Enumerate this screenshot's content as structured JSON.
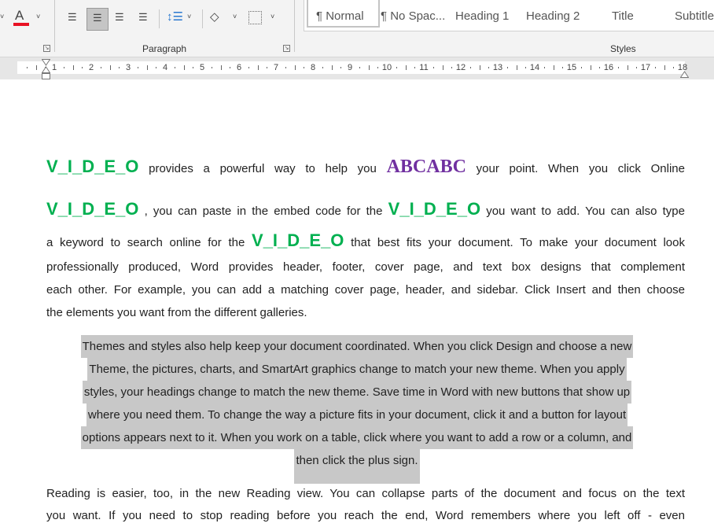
{
  "ribbon": {
    "groups": {
      "paragraph": "Paragraph",
      "styles": "Styles"
    },
    "icons": [
      "font-color-icon",
      "align-left-icon",
      "align-center-icon",
      "align-right-icon",
      "justify-icon",
      "line-spacing-icon",
      "shading-icon",
      "borders-icon"
    ],
    "font_color": "#e81123",
    "styles": [
      {
        "label": "¶ Normal"
      },
      {
        "label": "¶ No Spac..."
      },
      {
        "label": "Heading 1"
      },
      {
        "label": "Heading 2"
      },
      {
        "label": "Title"
      },
      {
        "label": "Subtitle"
      }
    ]
  },
  "ruler": {
    "numbers": [
      1,
      2,
      3,
      4,
      5,
      6,
      7,
      8,
      9,
      10,
      11,
      12,
      13,
      14,
      15,
      16,
      17,
      18
    ]
  },
  "document": {
    "colors": {
      "video": "#00b050",
      "abc": "#7030a0",
      "highlight": "#c8c8c8"
    },
    "p1": {
      "l1": [
        "V_I_D_E_O",
        " provides a powerful way to help you ",
        "ABCABC",
        " your point. When you click Online"
      ],
      "l2": [
        "V_I_D_E_O",
        " , you can paste in the embed code for the ",
        "V_I_D_E_O",
        " you want to add. You can also type"
      ],
      "l3": [
        "a keyword to search online for the ",
        "V_I_D_E_O",
        " that best fits your document. To make your document look"
      ],
      "l4": "professionally produced, Word provides header, footer, cover page, and text box designs that complement",
      "l5": "each other. For example, you can add a matching cover page, header, and sidebar. Click Insert and then choose",
      "l6": "the elements you want from the different galleries."
    },
    "p2": [
      "Themes and styles also help keep your document coordinated. When you click Design and choose a new",
      "Theme, the pictures, charts, and SmartArt graphics change to match your new theme. When you apply",
      "styles, your headings change to match the new theme. Save time in Word with new buttons that show up",
      "where you need them. To change the way a picture fits in your document, click it and a button for layout",
      "options appears next to it. When you work on a table, click where you want to add a row or a column, and",
      "then click the plus sign."
    ],
    "p3": [
      "Reading is easier, too, in the new Reading view. You can collapse parts of the document and focus on the text",
      "you want. If you need to stop reading before you reach the end, Word remembers where you left off - even"
    ]
  }
}
